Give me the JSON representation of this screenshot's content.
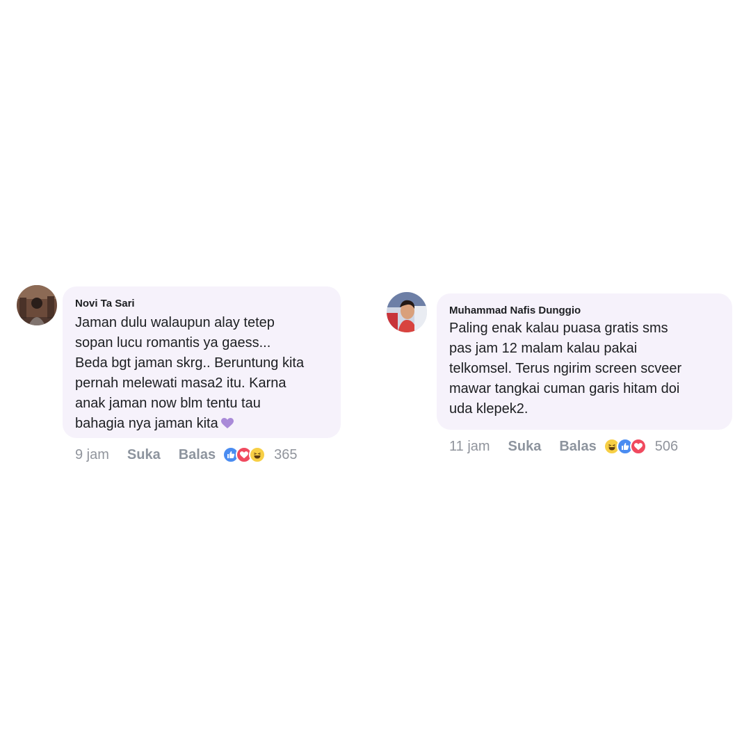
{
  "comments": [
    {
      "author": "Novi Ta Sari",
      "text_lines": [
        "Jaman dulu walaupun alay tetep",
        "sopan lucu romantis ya gaess...",
        "Beda bgt jaman skrg..  Beruntung kita",
        "pernah melewati masa2 itu.  Karna",
        "anak jaman now blm tentu tau",
        "bahagia nya jaman kita"
      ],
      "emoji": "purple-heart-icon",
      "time": "9 jam",
      "like_label": "Suka",
      "reply_label": "Balas",
      "reactions": [
        "like-icon",
        "love-icon",
        "haha-icon"
      ],
      "reaction_count": "365"
    },
    {
      "author": "Muhammad Nafis Dunggio",
      "text_lines": [
        "Paling enak kalau puasa gratis sms",
        "pas jam 12 malam kalau pakai",
        "telkomsel. Terus ngirim screen scveer",
        "mawar tangkai cuman garis hitam doi",
        "uda klepek2."
      ],
      "time": "11 jam",
      "like_label": "Suka",
      "reply_label": "Balas",
      "reactions": [
        "haha-icon",
        "like-icon",
        "love-icon"
      ],
      "reaction_count": "506"
    }
  ],
  "colors": {
    "bubble": "#f6f2fb",
    "like": "#4a8cf1",
    "love": "#f04a5f",
    "haha": "#f7cf45",
    "meta_text": "#90949c"
  }
}
